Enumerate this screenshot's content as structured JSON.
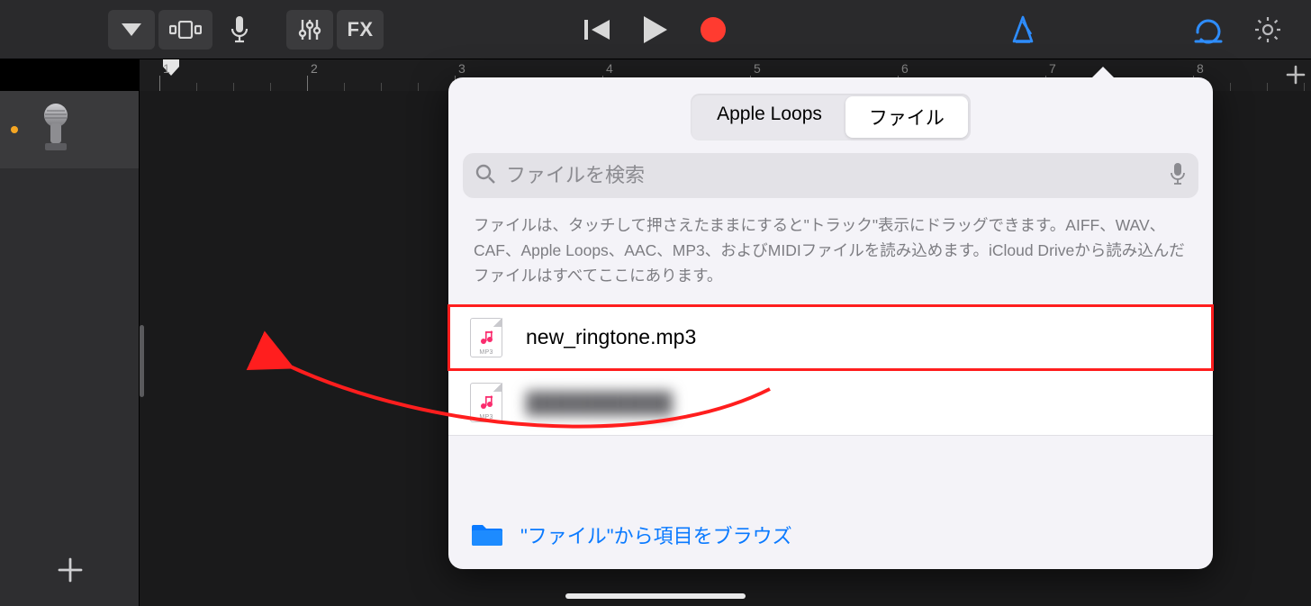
{
  "toolbar": {
    "fx_label": "FX",
    "accent": "#0a84ff"
  },
  "ruler": {
    "bars": [
      "1",
      "2",
      "3",
      "4",
      "5",
      "6",
      "7",
      "8"
    ]
  },
  "popover": {
    "tabs": {
      "loops": "Apple Loops",
      "files": "ファイル"
    },
    "search_placeholder": "ファイルを検索",
    "help_text": "ファイルは、タッチして押さえたままにすると\"トラック\"表示にドラッグできます。AIFF、WAV、CAF、Apple Loops、AAC、MP3、およびMIDIファイルを読み込めます。iCloud Driveから読み込んだファイルはすべてここにあります。",
    "files": [
      {
        "name": "new_ringtone.mp3",
        "ext": "MP3",
        "highlight": true,
        "blur": false
      },
      {
        "name": "██████████",
        "ext": "MP3",
        "highlight": false,
        "blur": true
      }
    ],
    "browse_label": "\"ファイル\"から項目をブラウズ"
  }
}
